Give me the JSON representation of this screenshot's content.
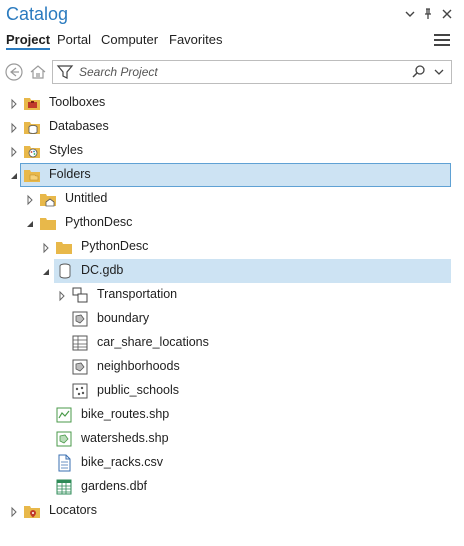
{
  "pane": {
    "title": "Catalog",
    "controls": {
      "dropdown": "▾",
      "pin": "📌",
      "close": "✕"
    }
  },
  "tabs": [
    {
      "label": "Project",
      "active": true
    },
    {
      "label": "Portal",
      "active": false
    },
    {
      "label": "Computer",
      "active": false
    },
    {
      "label": "Favorites",
      "active": false
    }
  ],
  "search": {
    "placeholder": "Search Project"
  },
  "tree": [
    {
      "label": "Toolboxes",
      "level": 0,
      "expander": "collapsed",
      "icon": "toolbox-folder-icon"
    },
    {
      "label": "Databases",
      "level": 0,
      "expander": "collapsed",
      "icon": "database-folder-icon"
    },
    {
      "label": "Styles",
      "level": 0,
      "expander": "collapsed",
      "icon": "styles-folder-icon"
    },
    {
      "label": "Folders",
      "level": 0,
      "expander": "expanded",
      "icon": "folders-icon",
      "state": "selected"
    },
    {
      "label": "Untitled",
      "level": 1,
      "expander": "collapsed",
      "icon": "home-folder-icon"
    },
    {
      "label": "PythonDesc",
      "level": 1,
      "expander": "expanded",
      "icon": "folder-icon"
    },
    {
      "label": "PythonDesc",
      "level": 2,
      "expander": "collapsed",
      "icon": "folder-icon"
    },
    {
      "label": "DC.gdb",
      "level": 2,
      "expander": "expanded",
      "icon": "geodatabase-icon",
      "state": "hover"
    },
    {
      "label": "Transportation",
      "level": 3,
      "expander": "collapsed",
      "icon": "feature-dataset-icon"
    },
    {
      "label": "boundary",
      "level": 3,
      "expander": "none",
      "icon": "polygon-feature-class-icon"
    },
    {
      "label": "car_share_locations",
      "level": 3,
      "expander": "none",
      "icon": "table-icon"
    },
    {
      "label": "neighborhoods",
      "level": 3,
      "expander": "none",
      "icon": "polygon-feature-class-icon"
    },
    {
      "label": "public_schools",
      "level": 3,
      "expander": "none",
      "icon": "point-feature-class-icon"
    },
    {
      "label": "bike_routes.shp",
      "level": 2,
      "expander": "none",
      "icon": "line-shapefile-icon"
    },
    {
      "label": "watersheds.shp",
      "level": 2,
      "expander": "none",
      "icon": "polygon-shapefile-icon"
    },
    {
      "label": "bike_racks.csv",
      "level": 2,
      "expander": "none",
      "icon": "csv-file-icon"
    },
    {
      "label": "gardens.dbf",
      "level": 2,
      "expander": "none",
      "icon": "dbf-table-icon"
    },
    {
      "label": "Locators",
      "level": 0,
      "expander": "collapsed",
      "icon": "locators-folder-icon"
    }
  ],
  "colors": {
    "accent": "#2b7bbf",
    "selection": "#cde3f3",
    "selection_border": "#5fa1d4",
    "folder": "#e8b84a"
  }
}
